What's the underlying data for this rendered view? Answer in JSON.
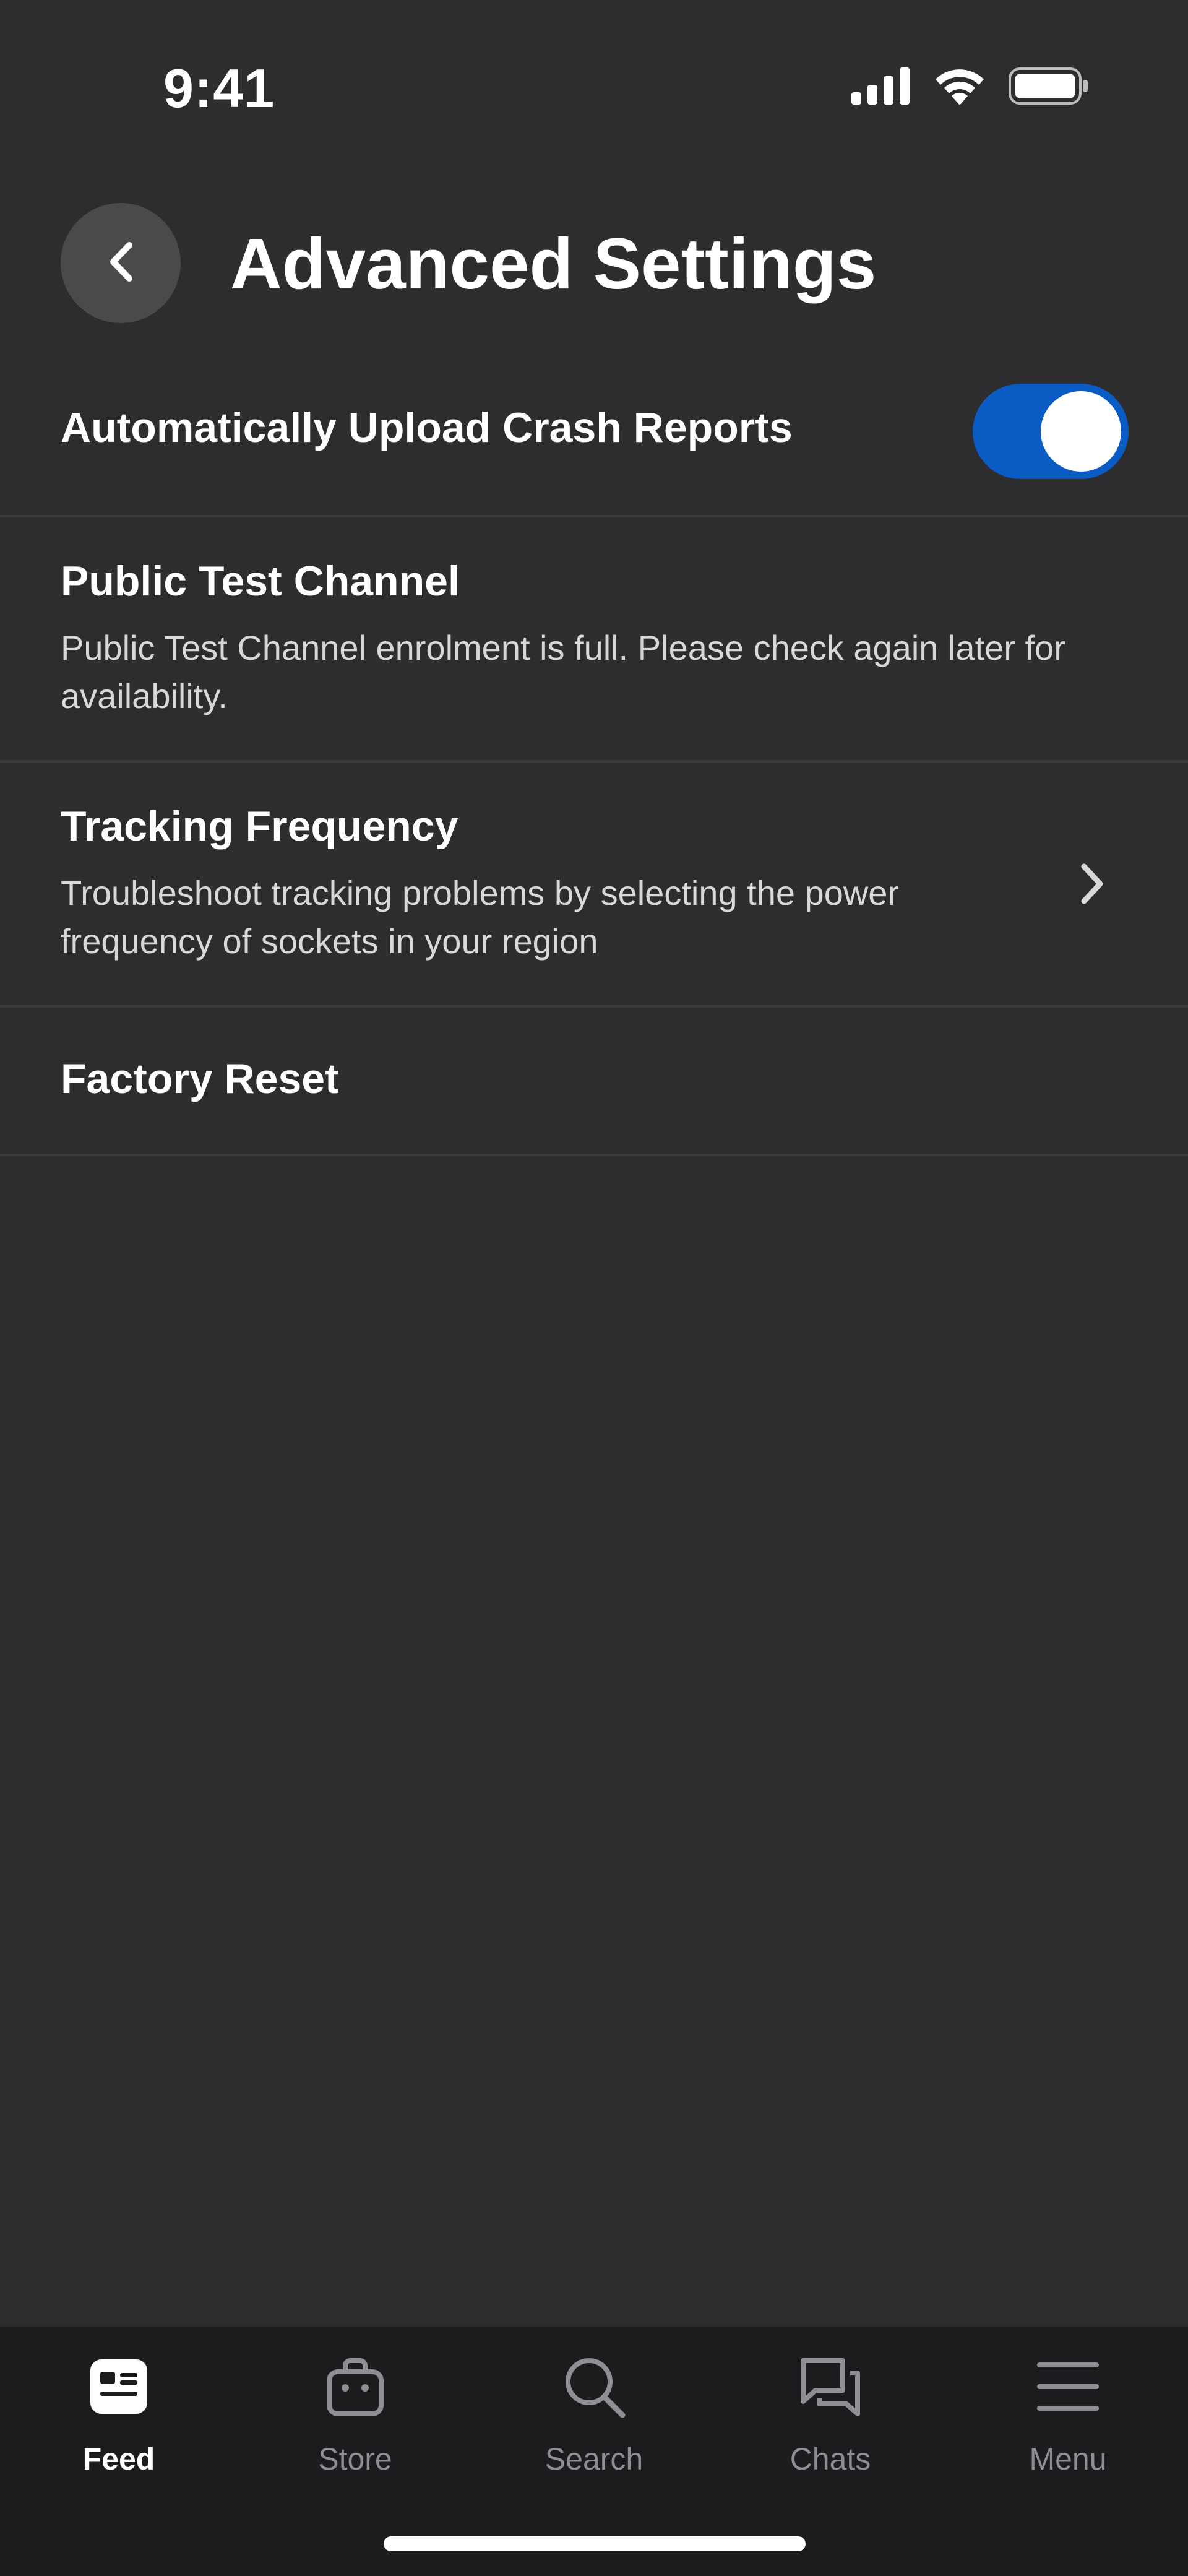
{
  "status_bar": {
    "time": "9:41",
    "icons": [
      "signal-icon",
      "wifi-icon",
      "battery-icon"
    ]
  },
  "header": {
    "title": "Advanced Settings",
    "back_icon": "chevron-left-icon"
  },
  "settings": {
    "crash_reports": {
      "label": "Automatically Upload Crash Reports",
      "enabled": true
    },
    "public_test_channel": {
      "title": "Public Test Channel",
      "description": "Public Test Channel enrolment is full. Please check again later for availability."
    },
    "tracking_frequency": {
      "title": "Tracking Frequency",
      "description": "Troubleshoot tracking problems by selecting the power frequency of sockets in your region"
    },
    "factory_reset": {
      "title": "Factory Reset"
    }
  },
  "tab_bar": {
    "items": [
      {
        "label": "Feed",
        "icon": "feed-icon",
        "active": true
      },
      {
        "label": "Store",
        "icon": "store-bag-icon",
        "active": false
      },
      {
        "label": "Search",
        "icon": "search-icon",
        "active": false
      },
      {
        "label": "Chats",
        "icon": "chats-icon",
        "active": false
      },
      {
        "label": "Menu",
        "icon": "menu-icon",
        "active": false
      }
    ]
  },
  "colors": {
    "background": "#2d2d2f",
    "accent": "#0a5bc4",
    "tab_bar": "#1c1c1e",
    "inactive": "#8e8e93"
  }
}
